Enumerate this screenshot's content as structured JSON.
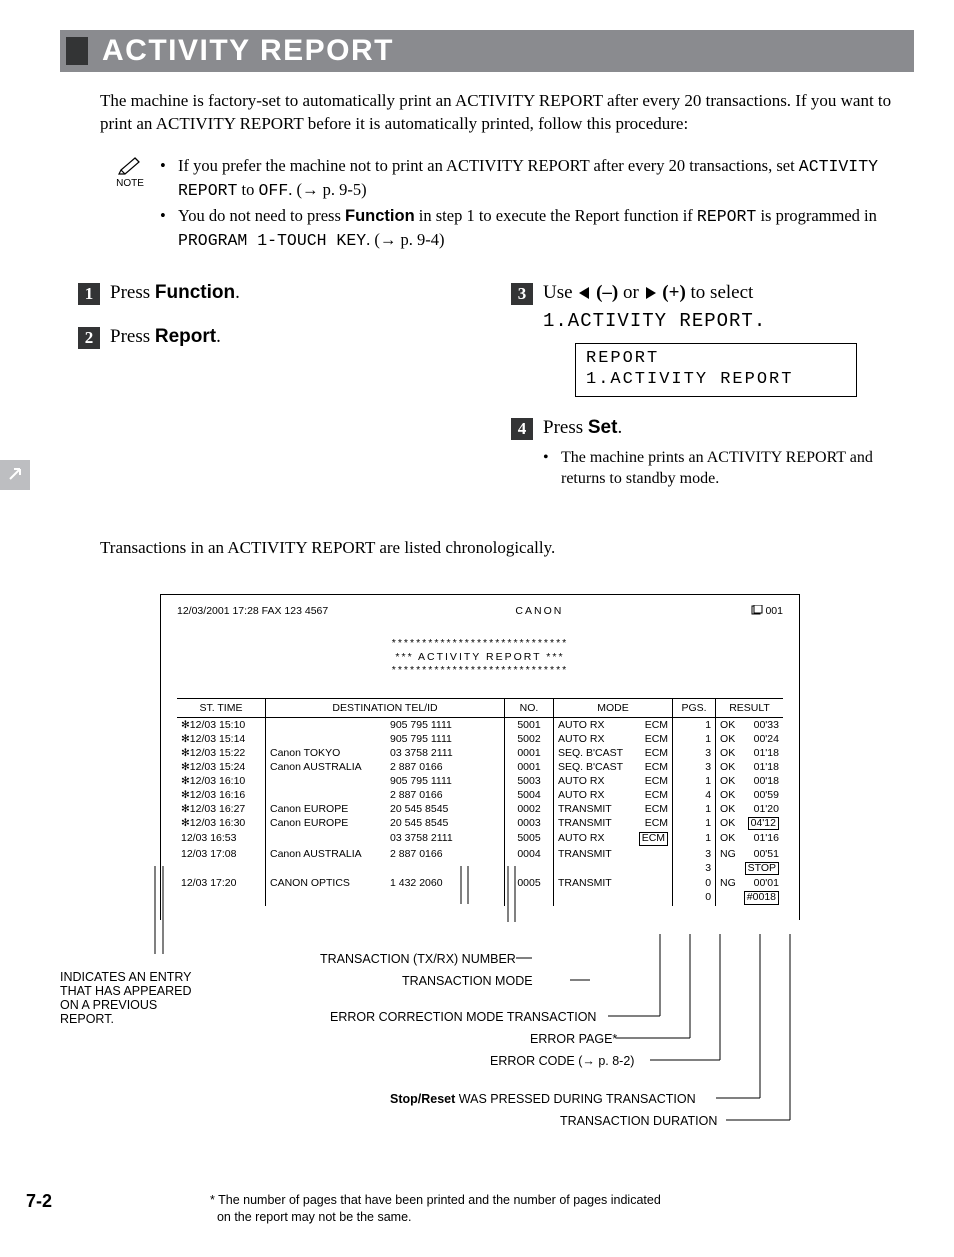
{
  "title": "ACTIVITY REPORT",
  "intro": "The machine is factory-set to automatically print an ACTIVITY REPORT after every 20 transactions. If you want to print an ACTIVITY REPORT before it is automatically printed, follow this procedure:",
  "note": {
    "label": "NOTE",
    "items": [
      {
        "pre": "If you prefer the machine not to print an ACTIVITY REPORT after every 20 transactions, set ",
        "code1": "ACTIVITY REPORT",
        "mid": " to ",
        "code2": "OFF",
        "post": ". (→ p. 9-5)"
      },
      {
        "pre": "You do not need to press ",
        "boldsans": "Function",
        "mid": " in step 1 to execute the Report function if ",
        "code1": "REPORT",
        "mid2": " is programmed in ",
        "code2": "PROGRAM 1-TOUCH KEY",
        "post": ". (→ p. 9-4)"
      }
    ]
  },
  "steps": {
    "s1": {
      "num": "1",
      "pre": "Press ",
      "key": "Function",
      "post": "."
    },
    "s2": {
      "num": "2",
      "pre": "Press ",
      "key": "Report",
      "post": "."
    },
    "s3": {
      "num": "3",
      "pre": "Use ",
      "minus": "(–)",
      "or": " or ",
      "plus": "(+)",
      "post": " to select",
      "line2": "1.ACTIVITY REPORT.",
      "lcd": {
        "l1": "REPORT",
        "l2": " 1.ACTIVITY REPORT"
      }
    },
    "s4": {
      "num": "4",
      "pre": "Press ",
      "key": "Set",
      "post": ".",
      "sub": "The machine prints an ACTIVITY REPORT and returns to standby mode."
    }
  },
  "chrono": "Transactions in an ACTIVITY REPORT are listed chronologically.",
  "report": {
    "header": {
      "left": "12/03/2001  17:28  FAX 123 4567",
      "center": "CANON",
      "right": "001"
    },
    "titleblock": {
      "stars": "*****************************",
      "title": "***   ACTIVITY REPORT   ***"
    },
    "columns": [
      "ST. TIME",
      "DESTINATION TEL/ID",
      "NO.",
      "MODE",
      "PGS.",
      "RESULT"
    ],
    "rows": [
      {
        "star": "✻",
        "time": "12/03  15:10",
        "name": "",
        "tel": "905 795 1111",
        "no": "5001",
        "mode": "AUTO RX",
        "ecm": "ECM",
        "pgs": "1",
        "res": "OK",
        "dur": "00'33"
      },
      {
        "star": "✻",
        "time": "12/03  15:14",
        "name": "",
        "tel": "905 795 1111",
        "no": "5002",
        "mode": "AUTO RX",
        "ecm": "ECM",
        "pgs": "1",
        "res": "OK",
        "dur": "00'24"
      },
      {
        "star": "✻",
        "time": "12/03  15:22",
        "name": "Canon TOKYO",
        "tel": "03 3758 2111",
        "no": "0001",
        "mode": "SEQ. B'CAST",
        "ecm": "ECM",
        "pgs": "3",
        "res": "OK",
        "dur": "01'18"
      },
      {
        "star": "✻",
        "time": "12/03  15:24",
        "name": "Canon AUSTRALIA",
        "tel": "2 887 0166",
        "no": "0001",
        "mode": "SEQ. B'CAST",
        "ecm": "ECM",
        "pgs": "3",
        "res": "OK",
        "dur": "01'18"
      },
      {
        "star": "✻",
        "time": "12/03  16:10",
        "name": "",
        "tel": "905 795 1111",
        "no": "5003",
        "mode": "AUTO RX",
        "ecm": "ECM",
        "pgs": "1",
        "res": "OK",
        "dur": "00'18"
      },
      {
        "star": "✻",
        "time": "12/03  16:16",
        "name": "",
        "tel": "2 887 0166",
        "no": "5004",
        "mode": "AUTO RX",
        "ecm": "ECM",
        "pgs": "4",
        "res": "OK",
        "dur": "00'59"
      },
      {
        "star": "✻",
        "time": "12/03  16:27",
        "name": "Canon EUROPE",
        "tel": "20 545 8545",
        "no": "0002",
        "mode": "TRANSMIT",
        "ecm": "ECM",
        "pgs": "1",
        "res": "OK",
        "dur": "01'20"
      },
      {
        "star": "✻",
        "time": "12/03  16:30",
        "name": "Canon EUROPE",
        "tel": "20 545 8545",
        "no": "0003",
        "mode": "TRANSMIT",
        "ecm": "ECM",
        "pgs": "1",
        "res": "OK",
        "dur": "04'12",
        "dur_boxed": true
      },
      {
        "star": "",
        "time": "12/03  16:53",
        "name": "",
        "tel": "03 3758 2111",
        "no": "5005",
        "mode": "AUTO RX",
        "ecm": "ECM",
        "ecm_boxed": true,
        "pgs": "1",
        "res": "OK",
        "dur": "01'16"
      },
      {
        "star": "",
        "time": "12/03  17:08",
        "name": "Canon AUSTRALIA",
        "tel": "2 887 0166",
        "no": "0004",
        "mode": "TRANSMIT",
        "ecm": "",
        "pgs": "3",
        "res": "NG",
        "dur": "00'51",
        "extra_pgs": "3",
        "extra_boxed": "STOP"
      },
      {
        "star": "",
        "time": "12/03  17:20",
        "name": "CANON OPTICS",
        "tel": "1 432 2060",
        "no": "0005",
        "mode": "TRANSMIT",
        "ecm": "",
        "pgs": "0",
        "res": "NG",
        "dur": "00'01",
        "extra_pgs": "0",
        "extra_boxed": "#0018"
      }
    ]
  },
  "callouts": {
    "txrx": "TRANSACTION (TX/RX) NUMBER",
    "tmode": "TRANSACTION MODE",
    "prev": "INDICATES AN ENTRY THAT HAS APPEARED ON A PREVIOUS REPORT.",
    "ecm": "ERROR CORRECTION MODE TRANSACTION",
    "errpage": "ERROR PAGE*",
    "errcode": "ERROR CODE (→ p. 8-2)",
    "stop_pre": "Stop/Reset",
    "stop_post": " WAS PRESSED DURING TRANSACTION",
    "duration": "TRANSACTION DURATION"
  },
  "footnote": {
    "l1": "* The number of pages that have been printed and the number of pages indicated",
    "l2": "on the report may not be the same."
  },
  "pagenum": "7-2"
}
